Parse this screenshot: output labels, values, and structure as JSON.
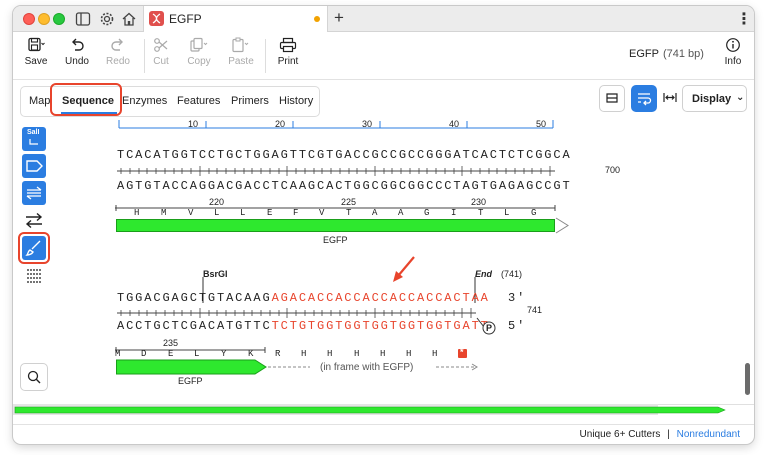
{
  "window": {
    "tab_title": "EGFP"
  },
  "toolbar": {
    "save": "Save",
    "undo": "Undo",
    "redo": "Redo",
    "cut": "Cut",
    "copy": "Copy",
    "paste": "Paste",
    "print": "Print",
    "info": "Info",
    "sequence_name": "EGFP",
    "sequence_length": "(741 bp)"
  },
  "view_tabs": {
    "map": "Map",
    "sequence": "Sequence",
    "enzymes": "Enzymes",
    "features": "Features",
    "primers": "Primers",
    "history": "History",
    "active": "Sequence"
  },
  "display_button": "Display",
  "palette": {
    "sali_label": "SalI"
  },
  "ruler": {
    "ticks": [
      "10",
      "20",
      "30",
      "40",
      "50"
    ]
  },
  "block1": {
    "top_strand": "TCACATGGTCCTGCTGGAGTTCGTGACCGCCGCCGGGATCACTCTCGGCA",
    "bottom_strand": "AGTGTACCAGGACGACCTCAAGCACTGGCGGCGGCCCTAGTGAGAGCCGT",
    "position": "700",
    "aa_numbers": [
      "220",
      "225",
      "230"
    ],
    "amino_acids": [
      "H",
      "M",
      "V",
      "L",
      "L",
      "E",
      "F",
      "V",
      "T",
      "A",
      "A",
      "G",
      "I",
      "T",
      "L",
      "G"
    ],
    "feature_label": "EGFP"
  },
  "block2": {
    "site_bsrgi": "BsrGI",
    "site_end": "End",
    "site_end_pos": "(741)",
    "top_black": "TGGACGAGCTGTACAAG",
    "top_red": "AGACACCACCACCACCACCACTAA",
    "top_end": "3'",
    "bottom_black": "ACCTGCTCGACATGTTC",
    "bottom_red": "TCTGTGGTGGTGGTGGTGGTGATT",
    "bottom_end": "5'",
    "position": "741",
    "aa_number": "235",
    "amino_acids_in_egfp": [
      "M",
      "D",
      "E",
      "L",
      "Y",
      "K"
    ],
    "amino_acids_tag": [
      "R",
      "H",
      "H",
      "H",
      "H",
      "H",
      "H"
    ],
    "frame_note": "(in frame with EGFP)",
    "feature_label": "EGFP",
    "promoter_badge": "P"
  },
  "status": {
    "unique_cutters": "Unique 6+ Cutters",
    "separator": "|",
    "nonredundant": "Nonredundant"
  },
  "colors": {
    "accent": "#2b7de1",
    "feature_green": "#2ee82e",
    "highlight_red": "#e8442c"
  }
}
